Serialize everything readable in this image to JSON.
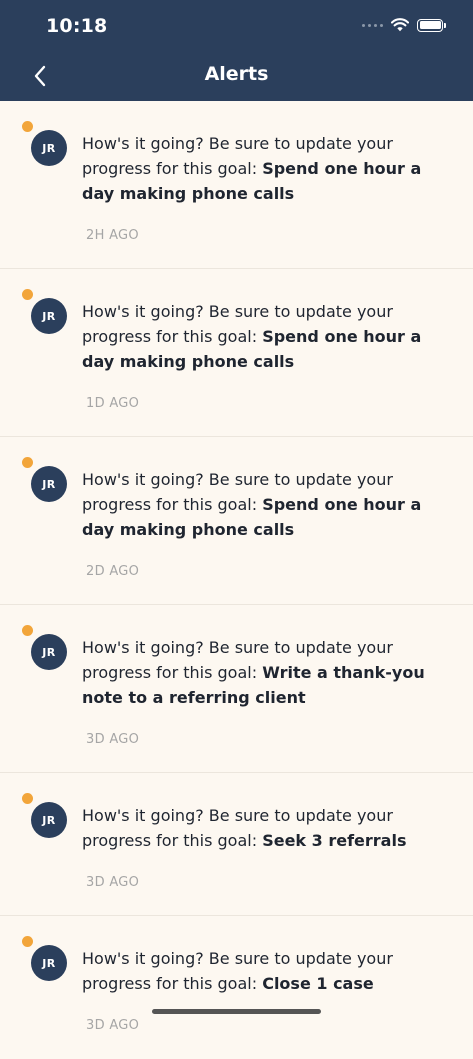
{
  "status_bar": {
    "time": "10:18"
  },
  "nav": {
    "title": "Alerts"
  },
  "alerts": [
    {
      "avatar": "JR",
      "prefix": "How's it going? Be sure to update your progress for this goal: ",
      "goal": "Spend one hour a day making phone calls",
      "time": "2H AGO"
    },
    {
      "avatar": "JR",
      "prefix": "How's it going? Be sure to update your progress for this goal: ",
      "goal": "Spend one hour a day making phone calls",
      "time": "1D AGO"
    },
    {
      "avatar": "JR",
      "prefix": "How's it going? Be sure to update your progress for this goal: ",
      "goal": "Spend one hour a day making phone calls",
      "time": "2D AGO"
    },
    {
      "avatar": "JR",
      "prefix": "How's it going? Be sure to update your progress for this goal: ",
      "goal": "Write a thank-you note to a referring client",
      "time": "3D AGO"
    },
    {
      "avatar": "JR",
      "prefix": "How's it going? Be sure to update your progress for this goal: ",
      "goal": "Seek 3 referrals",
      "time": "3D AGO"
    },
    {
      "avatar": "JR",
      "prefix": "How's it going? Be sure to update your progress for this goal: ",
      "goal": "Close 1 case",
      "time": "3D AGO"
    }
  ],
  "icons": {
    "back": "chevron-left-icon",
    "wifi": "wifi-icon",
    "battery": "battery-icon",
    "signal": "cellular-signal-icon"
  },
  "colors": {
    "header": "#2b3f5c",
    "background": "#fdf8f1",
    "unread_dot": "#f2a53a",
    "timestamp": "#a6a6a6"
  }
}
